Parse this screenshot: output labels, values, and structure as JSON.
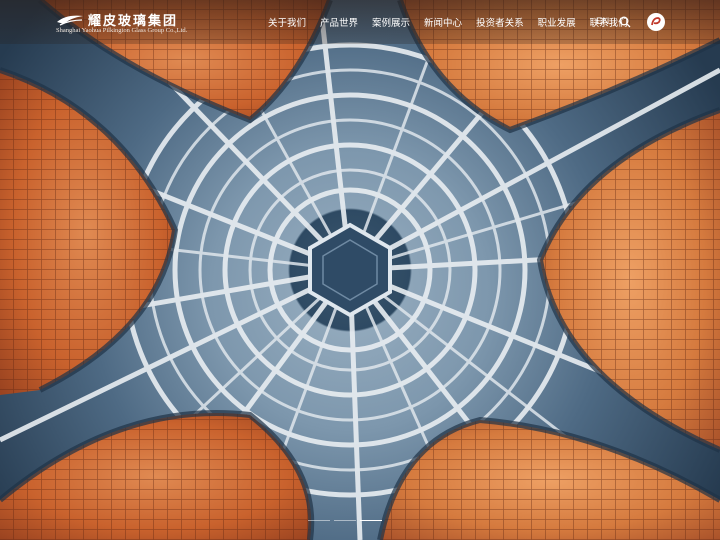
{
  "header": {
    "logo": {
      "cn_text": "耀皮玻璃集团",
      "en_text": "Shanghai Yaohua Pilkington Glass Group Co.,Ltd.",
      "icon": "company-logo-mark"
    },
    "nav": [
      {
        "label": "关于我们"
      },
      {
        "label": "产品世界"
      },
      {
        "label": "案例展示"
      },
      {
        "label": "新闻中心"
      },
      {
        "label": "投资者关系"
      },
      {
        "label": "职业发展"
      },
      {
        "label": "联系我们"
      }
    ],
    "language": "EN",
    "search_icon": "search-icon",
    "badge_icon": "brand-badge-icon"
  },
  "hero": {
    "image": "aerial view of star-shaped airport terminal roof",
    "slides": 3,
    "active_slide": 1
  },
  "colors": {
    "roof_orange": "#d9733c",
    "glass_blue": "#5d7891",
    "frame_white": "#e8eef2",
    "brand_red": "#c0392b"
  }
}
